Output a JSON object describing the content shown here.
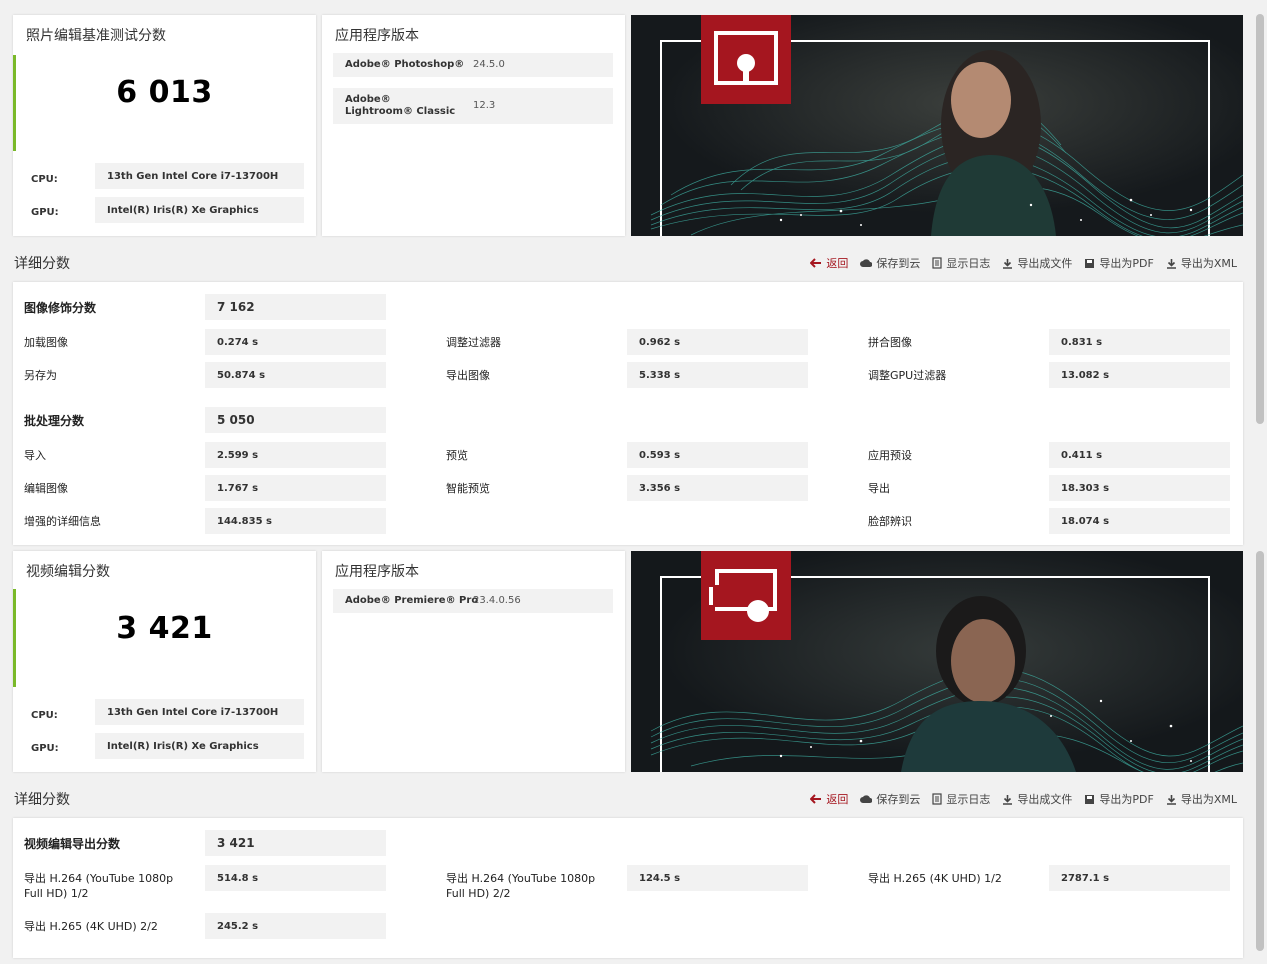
{
  "photo": {
    "score_card": {
      "title": "照片编辑基准测试分数",
      "score": "6 013",
      "cpu_label": "CPU:",
      "cpu_value": "13th Gen Intel Core i7-13700H",
      "gpu_label": "GPU:",
      "gpu_value": "Intel(R) Iris(R) Xe Graphics"
    },
    "app_card": {
      "title": "应用程序版本",
      "apps": [
        {
          "name": "Adobe® Photoshop®",
          "version": "24.5.0"
        },
        {
          "name": "Adobe® Lightroom® Classic",
          "version": "12.3"
        }
      ]
    },
    "detail": {
      "title": "详细分数",
      "image_retouch": {
        "label": "图像修饰分数",
        "value": "7 162",
        "rows": [
          {
            "label": "加载图像",
            "value": "0.274 s"
          },
          {
            "label": "调整过滤器",
            "value": "0.962 s"
          },
          {
            "label": "拼合图像",
            "value": "0.831 s"
          },
          {
            "label": "另存为",
            "value": "50.874 s"
          },
          {
            "label": "导出图像",
            "value": "5.338 s"
          },
          {
            "label": "调整GPU过滤器",
            "value": "13.082 s"
          }
        ]
      },
      "batch": {
        "label": "批处理分数",
        "value": "5 050",
        "rows": [
          {
            "label": "导入",
            "value": "2.599 s"
          },
          {
            "label": "预览",
            "value": "0.593 s"
          },
          {
            "label": "应用预设",
            "value": "0.411 s"
          },
          {
            "label": "编辑图像",
            "value": "1.767 s"
          },
          {
            "label": "智能预览",
            "value": "3.356 s"
          },
          {
            "label": "导出",
            "value": "18.303 s"
          },
          {
            "label": "增强的详细信息",
            "value": "144.835 s"
          },
          {
            "label": "脸部辨识",
            "value": "18.074 s"
          }
        ]
      }
    }
  },
  "video": {
    "score_card": {
      "title": "视频编辑分数",
      "score": "3 421",
      "cpu_label": "CPU:",
      "cpu_value": "13th Gen Intel Core i7-13700H",
      "gpu_label": "GPU:",
      "gpu_value": "Intel(R) Iris(R) Xe Graphics"
    },
    "app_card": {
      "title": "应用程序版本",
      "apps": [
        {
          "name": "Adobe® Premiere® Pro",
          "version": "23.4.0.56"
        }
      ]
    },
    "detail": {
      "title": "详细分数",
      "export": {
        "label": "视频编辑导出分数",
        "value": "3 421",
        "rows": [
          {
            "label": "导出 H.264 (YouTube 1080p Full HD) 1/2",
            "value": "514.8 s"
          },
          {
            "label": "导出 H.264 (YouTube 1080p Full HD) 2/2",
            "value": "124.5 s"
          },
          {
            "label": "导出 H.265 (4K UHD) 1/2",
            "value": "2787.1 s"
          },
          {
            "label": "导出 H.265 (4K UHD) 2/2",
            "value": "245.2 s"
          }
        ]
      }
    }
  },
  "toolbar": {
    "back": "返回",
    "save_cloud": "保存到云",
    "show_log": "显示日志",
    "export_file": "导出成文件",
    "export_pdf": "导出为PDF",
    "export_xml": "导出为XML"
  },
  "colors": {
    "accent_green": "#7ab929",
    "brand_red": "#a5161f",
    "hero_bg": "#1c2226"
  },
  "icons": [
    "photo-app-icon",
    "video-app-icon",
    "back-arrow-icon",
    "cloud-upload-icon",
    "document-icon",
    "download-icon",
    "save-disk-icon"
  ]
}
